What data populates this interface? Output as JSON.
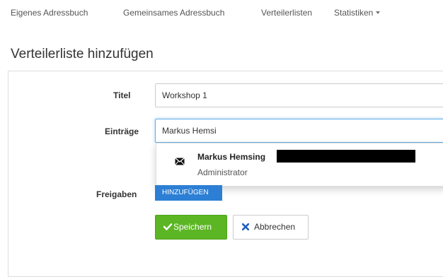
{
  "nav": {
    "items": [
      {
        "label": "Eigenes Adressbuch"
      },
      {
        "label": "Gemeinsames Adressbuch"
      },
      {
        "label": "Verteilerlisten"
      },
      {
        "label": "Statistiken"
      }
    ]
  },
  "page": {
    "title": "Verteilerliste hinzufügen"
  },
  "form": {
    "titel": {
      "label": "Titel",
      "value": "Workshop 1"
    },
    "eintraege": {
      "label": "Einträge",
      "value": "Markus Hemsi"
    },
    "freigaben": {
      "label": "Freigaben",
      "add_button": "HINZUFÜGEN"
    },
    "save_button": "Speichern",
    "cancel_button": "Abbrechen"
  },
  "suggestion": {
    "name": "Markus Hemsing",
    "role": "Administrator",
    "icon": "envelope-icon"
  },
  "colors": {
    "primary": "#2c7fd4",
    "success": "#5cb624",
    "danger": "#1f5fbf"
  }
}
